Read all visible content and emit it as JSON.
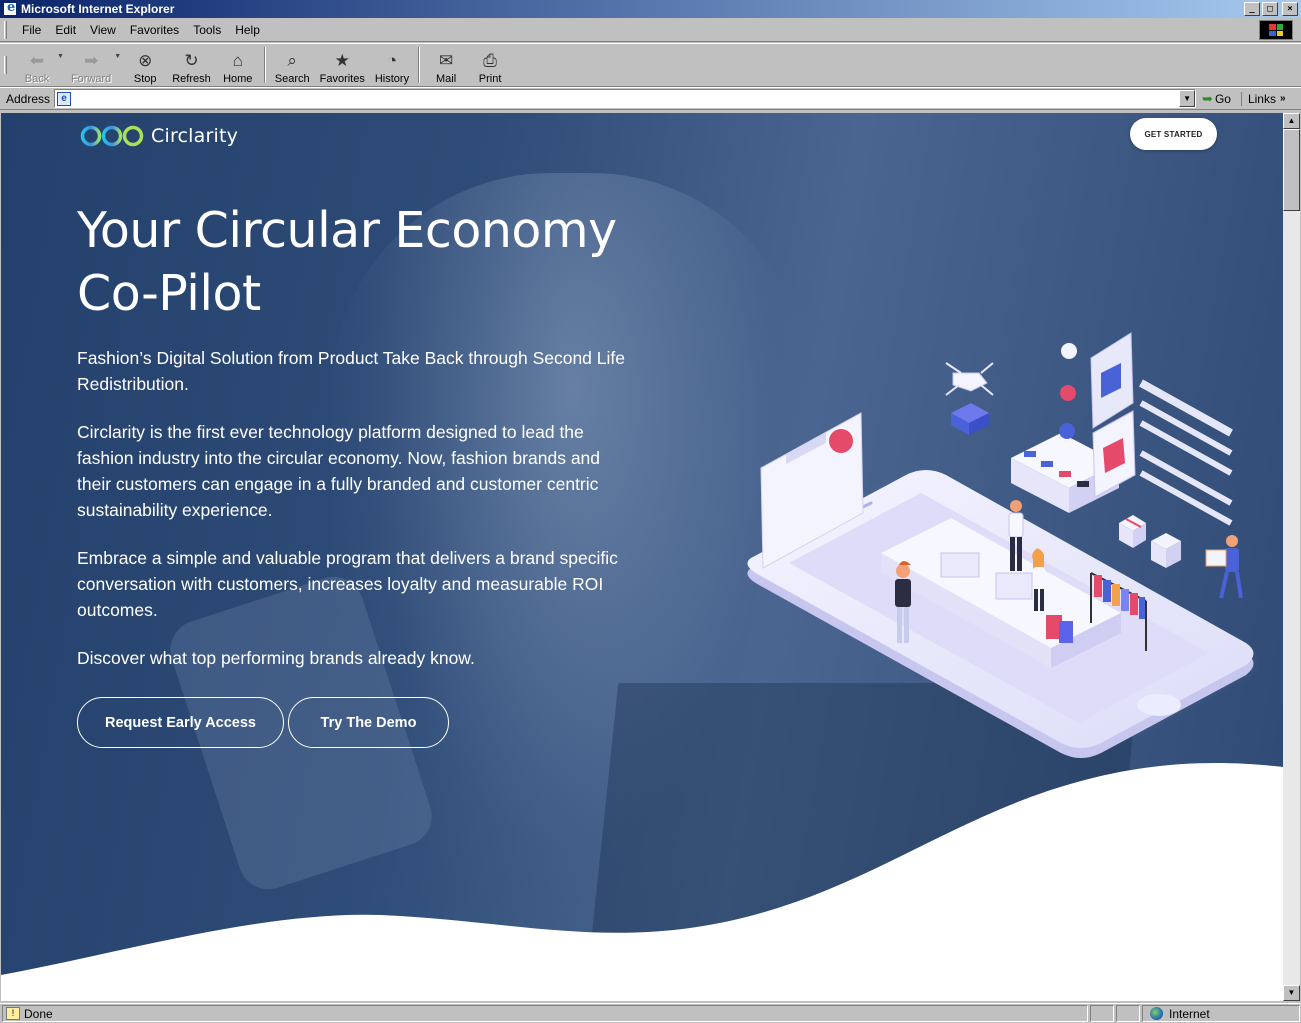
{
  "window": {
    "title": "Microsoft Internet Explorer",
    "controls": [
      "_",
      "□",
      "×"
    ]
  },
  "menu": [
    "File",
    "Edit",
    "View",
    "Favorites",
    "Tools",
    "Help"
  ],
  "toolbar": {
    "back": "Back",
    "forward": "Forward",
    "stop": "Stop",
    "refresh": "Refresh",
    "home": "Home",
    "search": "Search",
    "favorites": "Favorites",
    "history": "History",
    "mail": "Mail",
    "print": "Print"
  },
  "address": {
    "label": "Address",
    "value": "",
    "go": "Go",
    "links": "Links"
  },
  "page": {
    "brand": "Circlarity",
    "get_started": "GET STARTED",
    "title_line1": "Your Circular Economy",
    "title_line2": "Co-Pilot",
    "p1": "Fashion’s Digital Solution from Product Take Back through Second Life Redistribution.",
    "p2": "Circlarity is the first ever technology platform designed to lead the fashion industry into the circular economy. Now, fashion brands and their customers can engage in a fully branded and customer centric sustainability experience.",
    "p3": "Embrace a simple and valuable program that delivers a brand specific conversation with customers, increases loyalty and measurable ROI outcomes.",
    "p4": "Discover what top performing brands already know.",
    "btn_early": "Request Early Access",
    "btn_demo": "Try The Demo"
  },
  "status": {
    "text": "Done",
    "zone": "Internet"
  },
  "colors": {
    "titlebar_start": "#0a246a",
    "hero_overlay": "#2f4d78",
    "accent_lilac": "#c9c8f4"
  }
}
